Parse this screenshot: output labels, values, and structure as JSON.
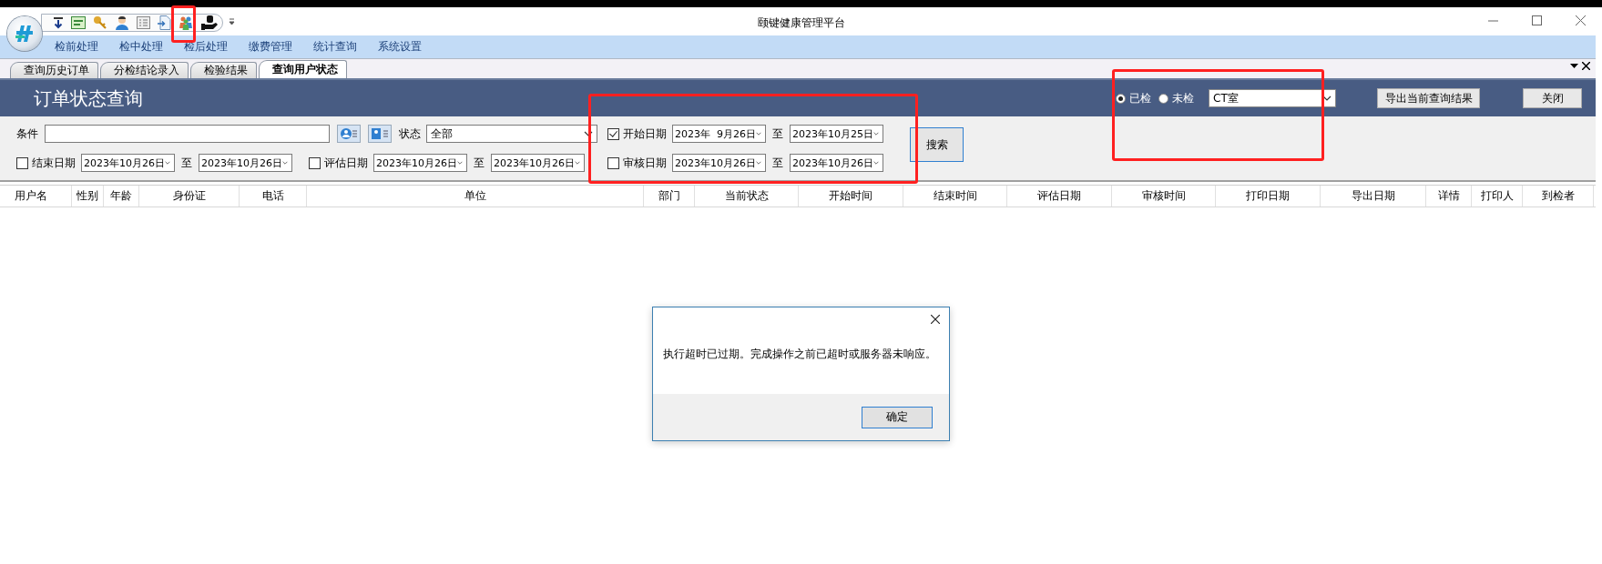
{
  "window": {
    "title": "颐键健康管理平台"
  },
  "menu": [
    "检前处理",
    "检中处理",
    "检后处理",
    "缴费管理",
    "统计查询",
    "系统设置"
  ],
  "tabs": [
    {
      "label": "查询历史订单",
      "selected": false
    },
    {
      "label": "分检结论录入",
      "selected": false
    },
    {
      "label": "检验结果",
      "selected": false
    },
    {
      "label": "查询用户状态",
      "selected": true
    }
  ],
  "header": {
    "title": "订单状态查询",
    "radios": [
      {
        "label": "已检",
        "selected": true
      },
      {
        "label": "未检",
        "selected": false
      }
    ],
    "room_select": {
      "value": "CT室"
    },
    "buttons": [
      "导出当前查询结果",
      "关闭"
    ]
  },
  "filters": {
    "condition": {
      "label": "条件"
    },
    "status": {
      "label": "状态",
      "value": "全部"
    },
    "date_filters": [
      {
        "label": "开始日期",
        "checked": true,
        "from": "2023年  9月26日",
        "to_label": "至",
        "to": "2023年10月25日"
      },
      {
        "label": "结束日期",
        "checked": false,
        "from": "2023年10月26日",
        "to_label": "至",
        "to": "2023年10月26日"
      },
      {
        "label": "评估日期",
        "checked": false,
        "from": "2023年10月26日",
        "to_label": "至",
        "to": "2023年10月26日"
      },
      {
        "label": "审核日期",
        "checked": false,
        "from": "2023年10月26日",
        "to_label": "至",
        "to": "2023年10月26日"
      }
    ],
    "search_button": "搜索"
  },
  "table": {
    "columns": [
      "用户名",
      "性别",
      "年龄",
      "身份证",
      "电话",
      "单位",
      "部门",
      "当前状态",
      "开始时间",
      "结束时间",
      "评估日期",
      "审核时间",
      "打印日期",
      "导出日期",
      "详情",
      "打印人",
      "到检者"
    ]
  },
  "dialog": {
    "message": "执行超时已过期。完成操作之前已超时或服务器未响应。",
    "buttons": [
      "确定"
    ]
  }
}
